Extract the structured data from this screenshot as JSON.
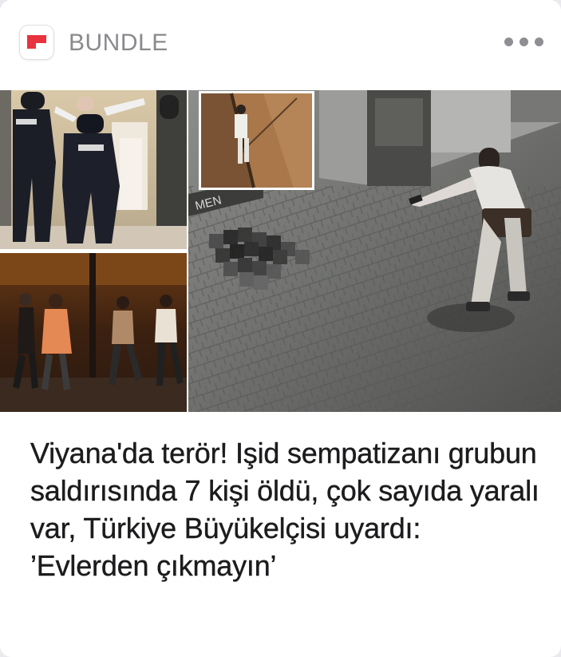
{
  "header": {
    "app_name": "BUNDLE",
    "app_icon": "bundle-logo-icon",
    "more_icon": "more-dots-icon"
  },
  "article": {
    "image_kind": "photo-collage",
    "headline": "Viyana'da terör! Işid sempatizanı grubun saldırısında 7 kişi öldü, çok sayıda yaralı var, Türkiye Büyükelçisi uyardı: ’Evlerden çıkmayın’"
  },
  "colors": {
    "brand_red": "#e8333f",
    "header_text": "#8a8a8e",
    "headline_text": "#1c1c1e"
  }
}
